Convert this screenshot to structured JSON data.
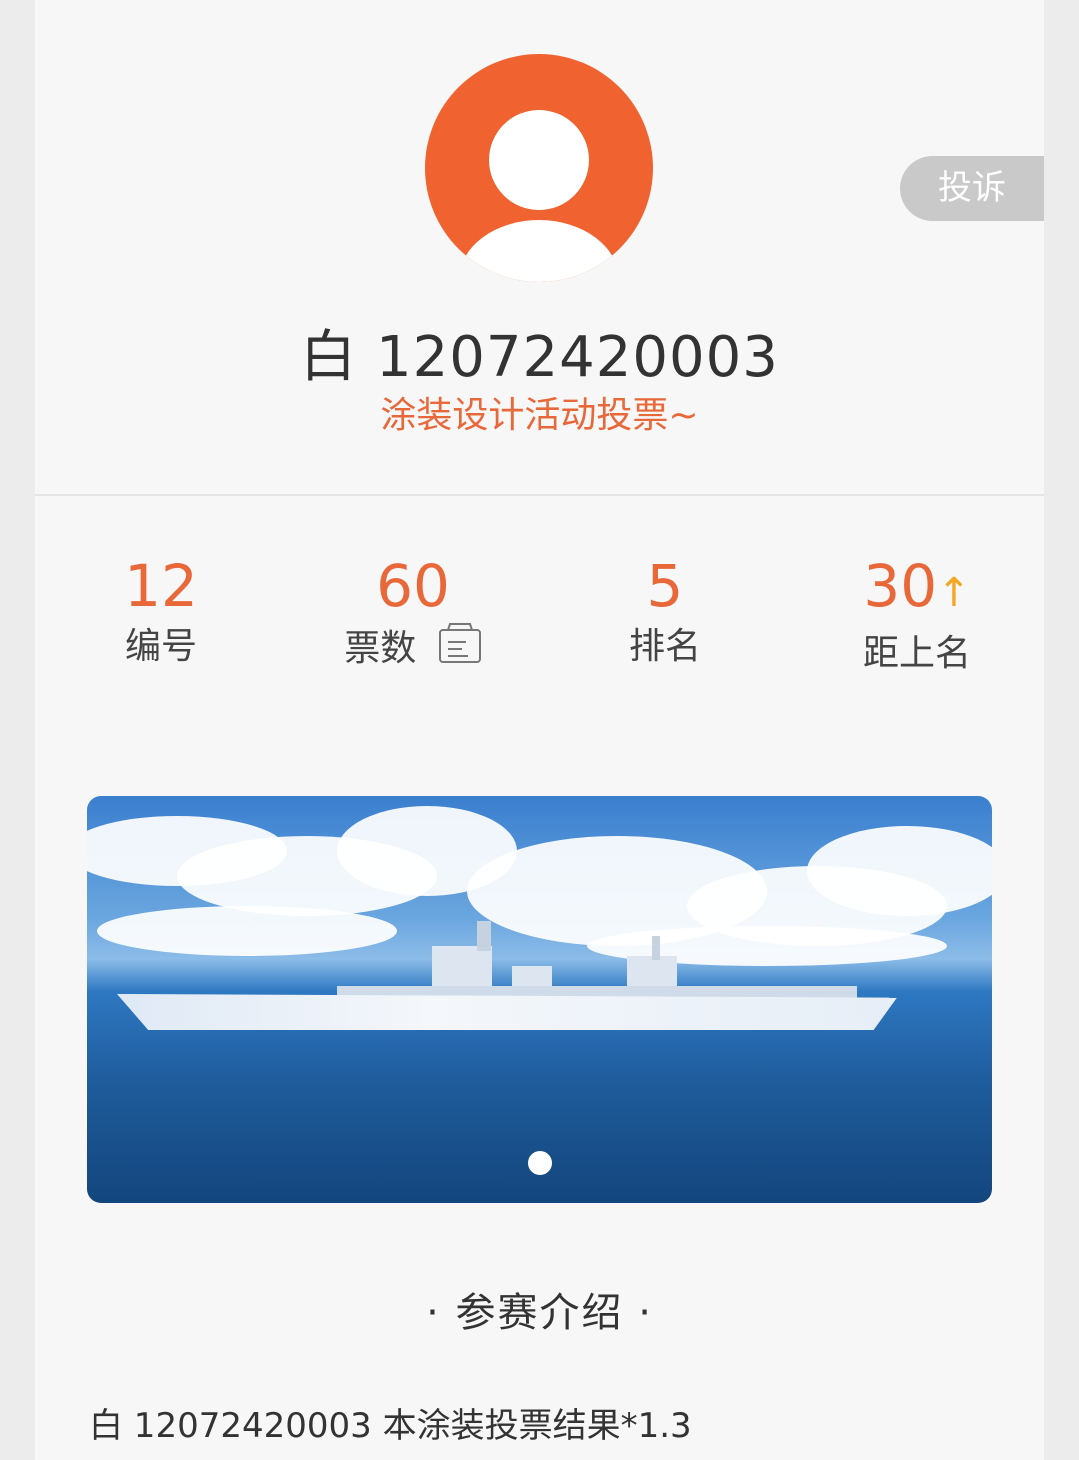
{
  "header": {
    "complain_label": "投诉",
    "title": "白 12072420003",
    "subtitle": "涂装设计活动投票~"
  },
  "stats": [
    {
      "value": "12",
      "label": "编号"
    },
    {
      "value": "60",
      "label": "票数"
    },
    {
      "value": "5",
      "label": "排名"
    },
    {
      "value": "30",
      "label": "距上名",
      "arrow": "↑"
    }
  ],
  "section": {
    "title": "· 参赛介绍 ·"
  },
  "intro": {
    "text": "白 12072420003 本涂装投票结果*1.3"
  },
  "colors": {
    "accent": "#e9683a",
    "avatar": "#f0622f",
    "arrow": "#f5a623"
  }
}
